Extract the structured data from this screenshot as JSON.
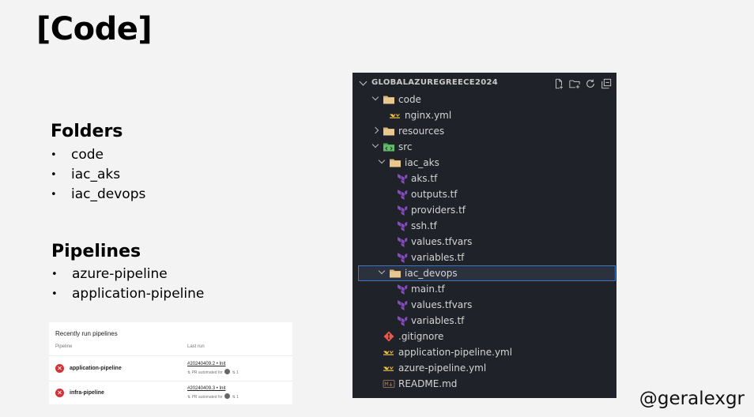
{
  "slide": {
    "title": "[Code]",
    "folders_heading": "Folders",
    "folders": [
      "code",
      "iac_aks",
      "iac_devops"
    ],
    "pipelines_heading": "Pipelines",
    "pipelines": [
      "azure-pipeline",
      "application-pipeline"
    ],
    "handle": "@geralexgr"
  },
  "runs_card": {
    "title": "Recently run pipelines",
    "col_pipeline": "Pipeline",
    "col_last_run": "Last run",
    "rows": [
      {
        "name": "application-pipeline",
        "run": "#20240409.2 • Init",
        "meta": "PR automated for",
        "count": "1",
        "status": "failed"
      },
      {
        "name": "infra-pipeline",
        "run": "#20240409.3 • Init",
        "meta": "PR automated for",
        "count": "1",
        "status": "failed"
      }
    ]
  },
  "explorer": {
    "root": "GLOBALAZUREGREECE2024",
    "actions": [
      "new-file-icon",
      "new-folder-icon",
      "refresh-icon",
      "collapse-all-icon"
    ],
    "tree": [
      {
        "label": "code",
        "type": "folder",
        "state": "open"
      },
      {
        "label": "nginx.yml",
        "type": "yaml"
      },
      {
        "label": "resources",
        "type": "folder",
        "state": "closed"
      },
      {
        "label": "src",
        "type": "src-folder",
        "state": "open"
      },
      {
        "label": "iac_aks",
        "type": "folder",
        "state": "open"
      },
      {
        "label": "aks.tf",
        "type": "terraform"
      },
      {
        "label": "outputs.tf",
        "type": "terraform"
      },
      {
        "label": "providers.tf",
        "type": "terraform"
      },
      {
        "label": "ssh.tf",
        "type": "terraform"
      },
      {
        "label": "values.tfvars",
        "type": "terraform"
      },
      {
        "label": "variables.tf",
        "type": "terraform"
      },
      {
        "label": "iac_devops",
        "type": "folder",
        "state": "open",
        "selected": true
      },
      {
        "label": "main.tf",
        "type": "terraform"
      },
      {
        "label": "values.tfvars",
        "type": "terraform"
      },
      {
        "label": "variables.tf",
        "type": "terraform"
      },
      {
        "label": ".gitignore",
        "type": "git"
      },
      {
        "label": "application-pipeline.yml",
        "type": "yaml"
      },
      {
        "label": "azure-pipeline.yml",
        "type": "yaml"
      },
      {
        "label": "README.md",
        "type": "markdown"
      }
    ]
  },
  "colors": {
    "explorer_bg": "#1f2228",
    "folder": "#dcb67a",
    "terraform": "#844fba",
    "yaml": "#f4c542",
    "git": "#e8574a",
    "src_folder": "#4caf50",
    "selection_border": "#3b73c9",
    "error": "#d13438"
  }
}
